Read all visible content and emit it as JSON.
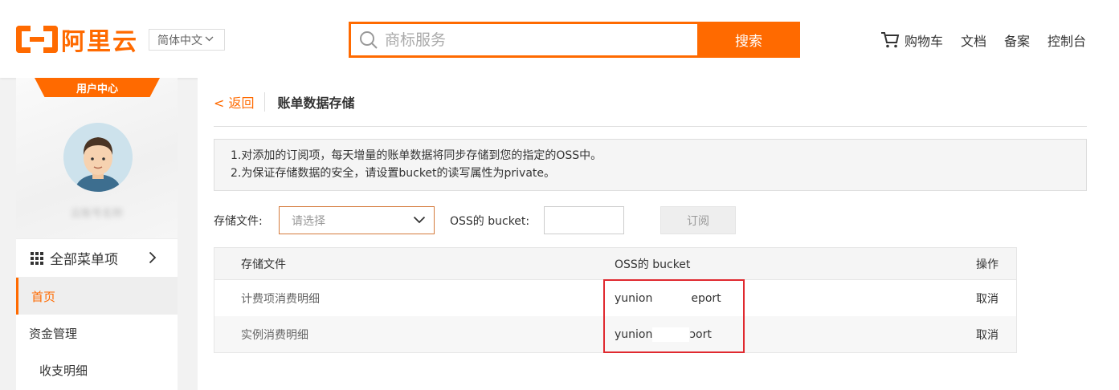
{
  "header": {
    "logo_text": "阿里云",
    "lang": "简体中文",
    "search_placeholder": "商标服务",
    "search_button": "搜索",
    "nav": [
      {
        "label": "购物车",
        "icon": "cart-icon"
      },
      {
        "label": "文档"
      },
      {
        "label": "备案"
      },
      {
        "label": "控制台"
      }
    ],
    "accent_color": "#ff6a00"
  },
  "sidebar": {
    "badge": "用户中心",
    "username": "云账号名称",
    "all_menu": "全部菜单项",
    "items": [
      {
        "label": "首页",
        "active": true
      },
      {
        "label": "资金管理"
      },
      {
        "label": "收支明细"
      }
    ]
  },
  "main": {
    "back": "< 返回",
    "title": "账单数据存储",
    "notice": [
      "1.对添加的订阅项，每天增量的账单数据将同步存储到您的指定的OSS中。",
      "2.为保证存储数据的安全，请设置bucket的读写属性为private。"
    ],
    "form": {
      "file_label": "存储文件:",
      "file_placeholder": "请选择",
      "bucket_label": "OSS的 bucket:",
      "bucket_value": "",
      "subscribe_button": "订阅"
    },
    "table": {
      "headers": [
        "存储文件",
        "OSS的 bucket",
        "操作"
      ],
      "rows": [
        {
          "file": "计费项消费明细",
          "bucket_start": "yunion",
          "bucket_end": "eport",
          "action": "取消"
        },
        {
          "file": "实例消费明细",
          "bucket_start": "yunion",
          "bucket_end": "ɔort",
          "action": "取消"
        }
      ]
    }
  }
}
